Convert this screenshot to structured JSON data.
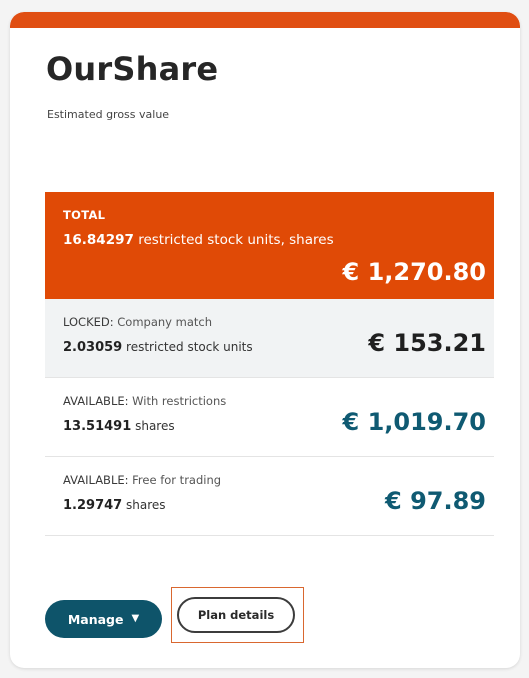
{
  "card": {
    "title": "OurShare",
    "subtitle": "Estimated gross value"
  },
  "total": {
    "label": "TOTAL",
    "units_number": "16.84297",
    "units_text": "restricted stock units, shares",
    "value": "€ 1,270.80"
  },
  "holdings": [
    {
      "status": "LOCKED:",
      "description": "Company match",
      "number": "2.03059",
      "unit": "restricted stock units",
      "value": "€ 153.21"
    },
    {
      "status": "AVAILABLE:",
      "description": "With restrictions",
      "number": "13.51491",
      "unit": "shares",
      "value": "€ 1,019.70"
    },
    {
      "status": "AVAILABLE:",
      "description": "Free for trading",
      "number": "1.29747",
      "unit": "shares",
      "value": "€ 97.89"
    }
  ],
  "actions": {
    "manage_label": "Manage",
    "manage_icon": "caret-down-icon",
    "plan_details_label": "Plan details"
  },
  "colors": {
    "accent_orange": "#e04a06",
    "teal": "#0f5a72",
    "manage_button": "#0e546a"
  }
}
